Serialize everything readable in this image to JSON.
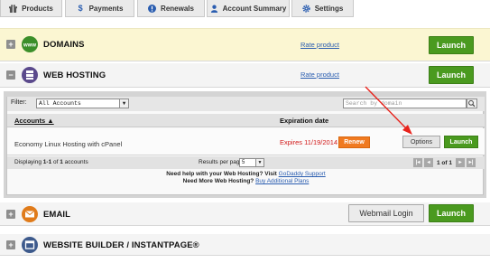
{
  "tabs": [
    {
      "label": "Products",
      "icon": "gift-icon"
    },
    {
      "label": "Payments",
      "icon": "dollar-icon"
    },
    {
      "label": "Renewals",
      "icon": "alert-icon"
    },
    {
      "label": "Account Summary",
      "icon": "user-icon"
    },
    {
      "label": "Settings",
      "icon": "gear-icon"
    }
  ],
  "products": {
    "domains": {
      "expander": "+",
      "title": "DOMAINS",
      "rate": "Rate product",
      "launch": "Launch",
      "icon": "www-icon"
    },
    "hosting": {
      "expander": "−",
      "title": "WEB HOSTING",
      "rate": "Rate product",
      "launch": "Launch",
      "icon": "server-icon"
    },
    "email": {
      "expander": "+",
      "title": "EMAIL",
      "webmail": "Webmail Login",
      "launch": "Launch",
      "icon": "envelope-icon"
    },
    "builder": {
      "expander": "+",
      "title": "WEBSITE BUILDER / INSTANTPAGE®",
      "icon": "builder-icon"
    }
  },
  "hosting_panel": {
    "filter_label": "Filter:",
    "filter_value": "All Accounts",
    "search_placeholder": "Search by domain",
    "col_accounts": "Accounts ▲",
    "col_expiration": "Expiration date",
    "rows": [
      {
        "account": "Economy Linux Hosting with cPanel",
        "expires": "Expires 11/19/2014",
        "renew": "Renew",
        "options": "Options",
        "launch": "Launch"
      }
    ],
    "displaying_prefix": "Displaying ",
    "displaying_range": "1-1",
    "displaying_of": " of ",
    "displaying_total": "1",
    "displaying_suffix": " accounts",
    "results_label": "Results per page:",
    "results_value": "5",
    "page_text": "1 of 1",
    "help_line1_text": "Need help with your Web Hosting? Visit ",
    "help_line1_link": "GoDaddy Support",
    "help_line2_text": "Need More Web Hosting? ",
    "help_line2_link": "Buy Additional Plans"
  },
  "colors": {
    "launch_green": "#4a9a1f",
    "renew_orange": "#f07a20",
    "expires_red": "#d21a1a",
    "domains_bg": "#fbf6d2",
    "annotation_arrow": "#e8231c"
  }
}
